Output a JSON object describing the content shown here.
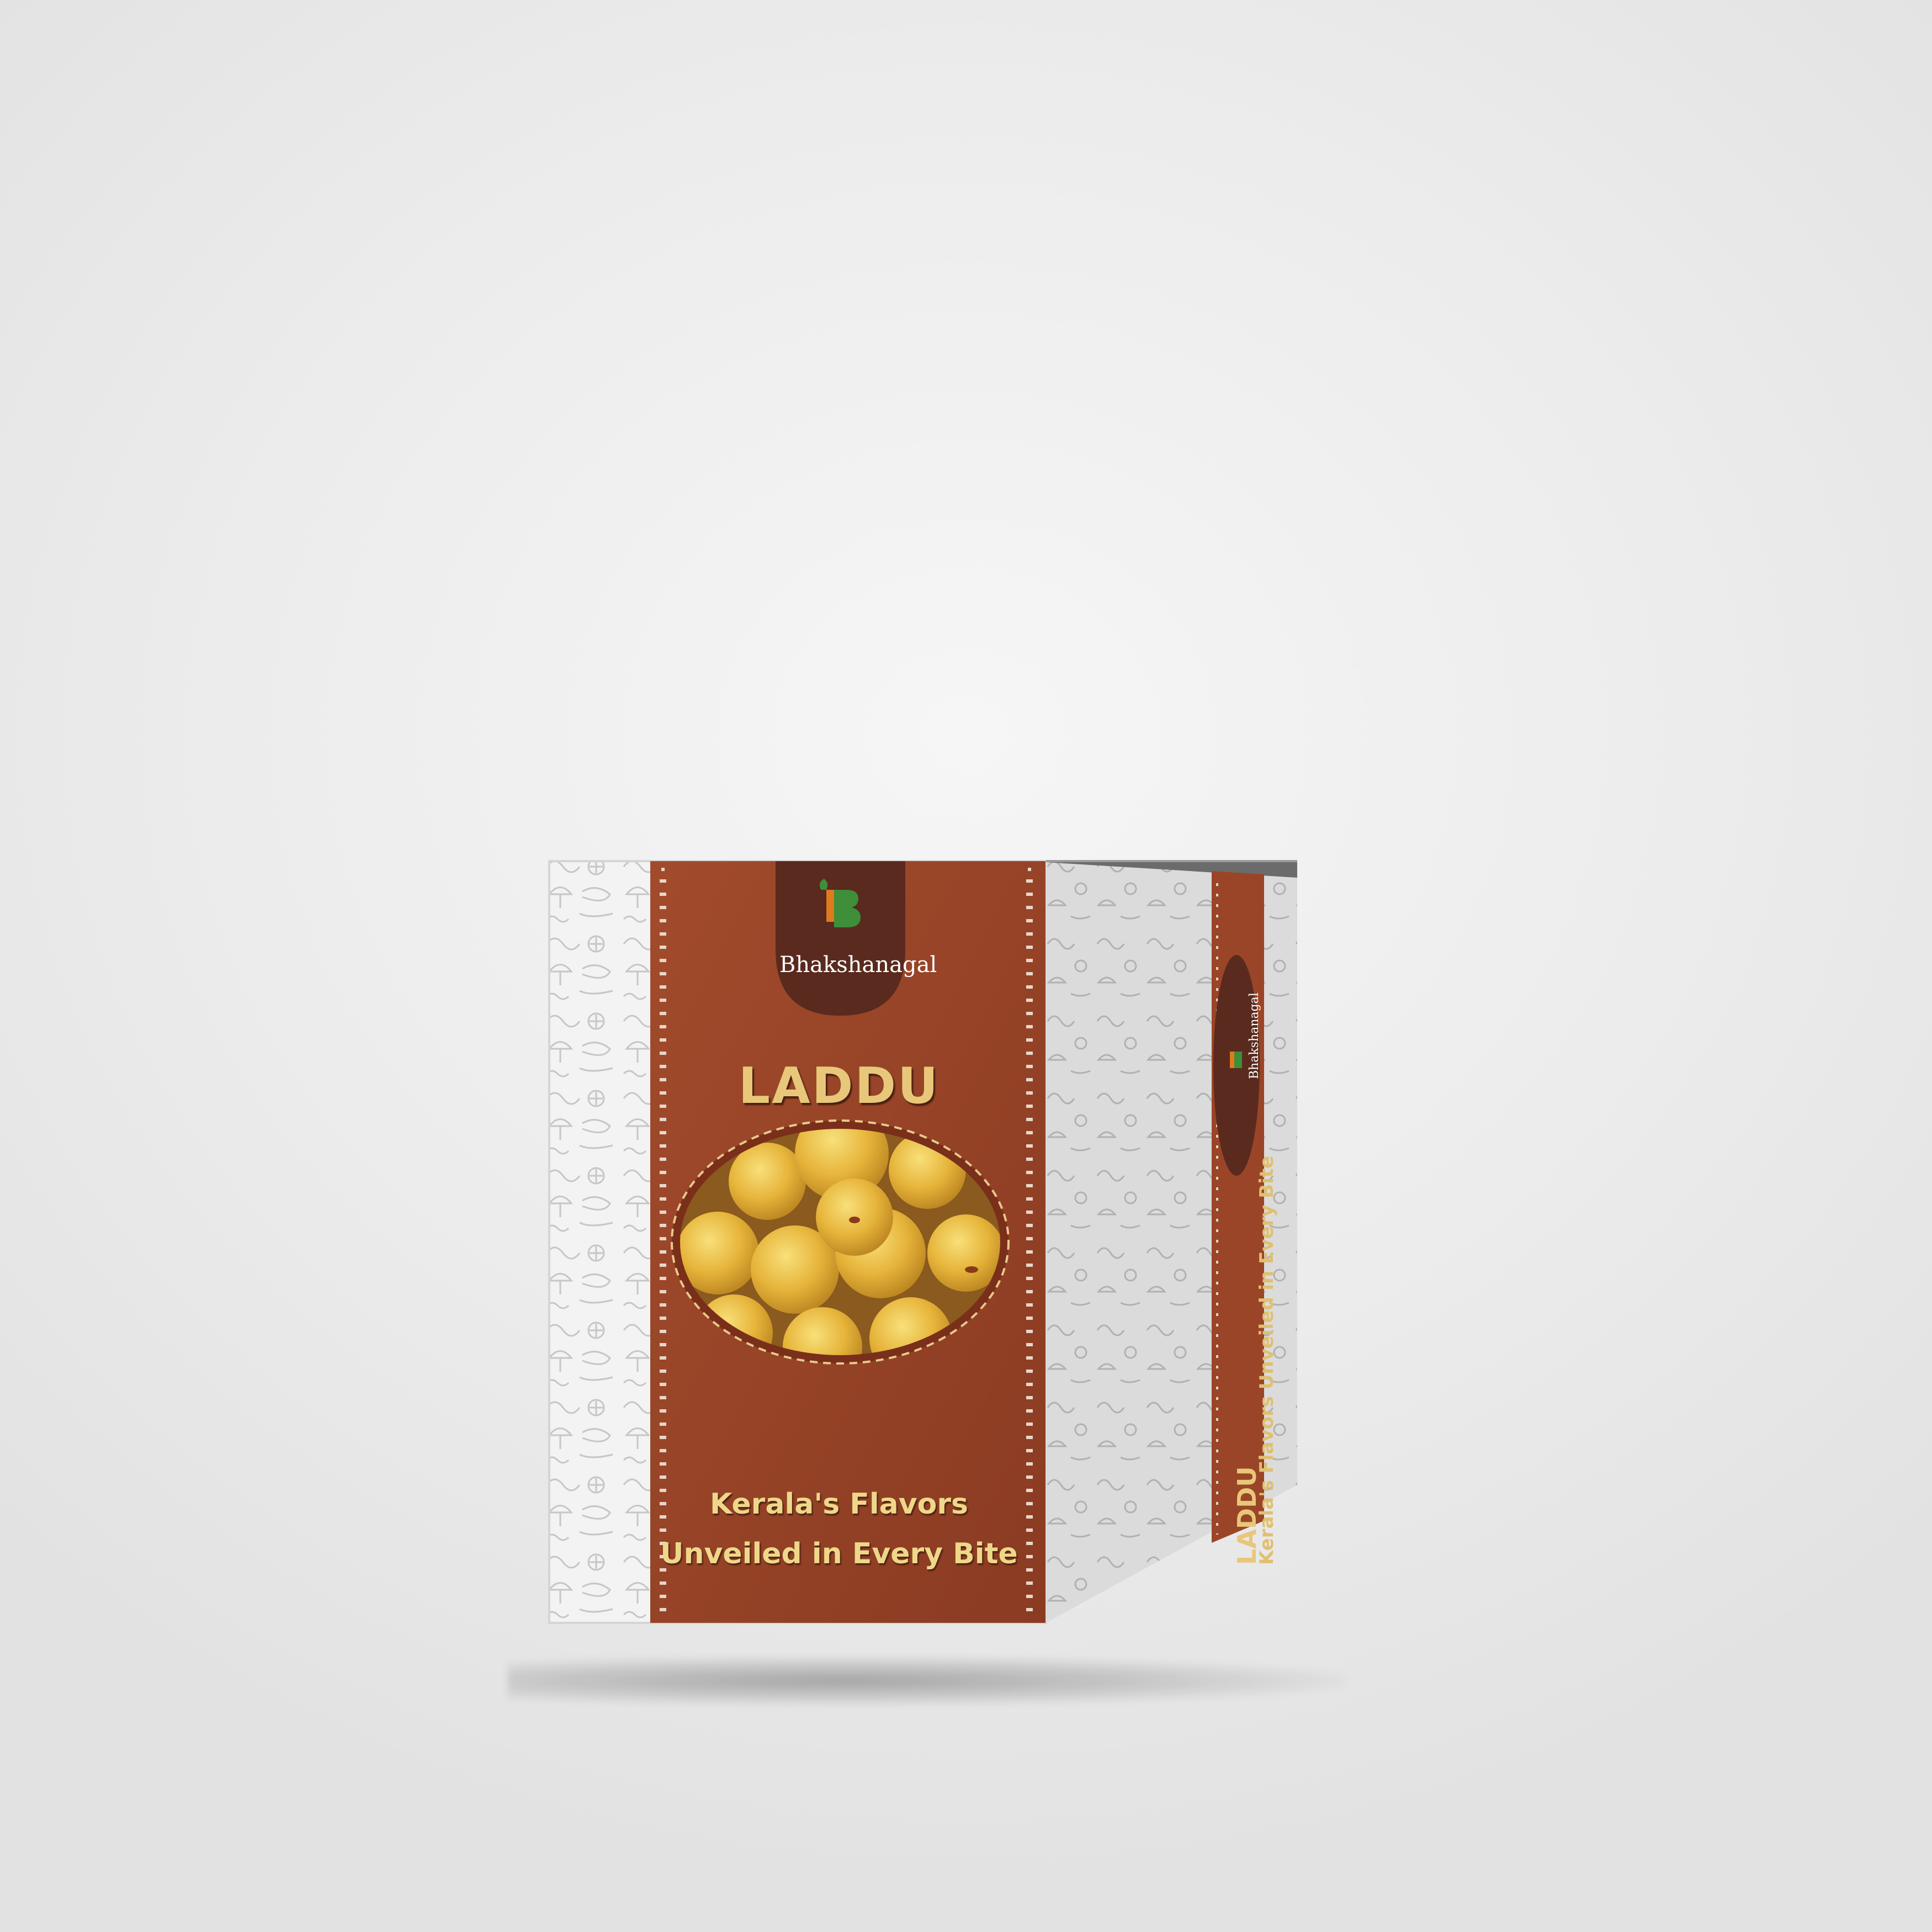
{
  "brand": {
    "name": "Bhakshanagal",
    "logo_letter": "B",
    "colors": {
      "logo_orange": "#e07a1f",
      "logo_green": "#3e8e3a",
      "badge_brown": "#5a2a1e"
    }
  },
  "front": {
    "product_name": "LADDU",
    "tagline_line1": "Kerala's Flavors",
    "tagline_line2": "Unveiled in Every Bite"
  },
  "side": {
    "brand_name": "Bhakshanagal",
    "product_name": "LADDU",
    "tagline": "Kerala's Flavors Unveiled in Every Bite"
  },
  "colors": {
    "band": "#9a4528",
    "band_dark": "#7e3520",
    "pattern_bg": "#f4f4f4",
    "pattern_line": "#c9c9c9",
    "gold_text": "#e8c77a",
    "laddu": "#e8b93a"
  }
}
